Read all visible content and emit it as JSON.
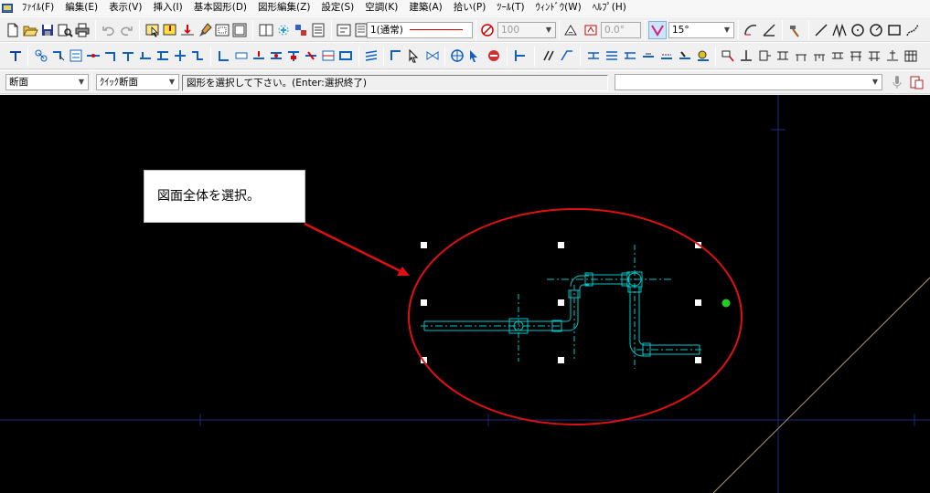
{
  "menubar": {
    "items": [
      "ﾌｧｲﾙ(F)",
      "編集(E)",
      "表示(V)",
      "挿入(I)",
      "基本図形(D)",
      "図形編集(Z)",
      "設定(S)",
      "空調(K)",
      "建築(A)",
      "拾い(P)",
      "ﾂｰﾙ(T)",
      "ｳｨﾝﾄﾞｳ(W)",
      "ﾍﾙﾌﾟ(H)"
    ]
  },
  "toolbar1": {
    "line_type": "1(通常)",
    "weight_value": "100",
    "angle_value": "0.0°",
    "snap_angle": "15°"
  },
  "toolbar3": {
    "layer_combo": "断面",
    "quick_combo": "ｸｲｯｸ断面",
    "status_prompt": "図形を選択して下さい。(Enter:選択終了)",
    "command_input": ""
  },
  "canvas": {
    "callout_text": "図面全体を選択。",
    "colors": {
      "background": "#000000",
      "pipe": "#00c8c8",
      "grid": "#1c2a7a",
      "annotation": "#e01010",
      "grip": "#ffffff",
      "base_grip": "#22cc22",
      "diagonal": "#b49a6a"
    }
  }
}
